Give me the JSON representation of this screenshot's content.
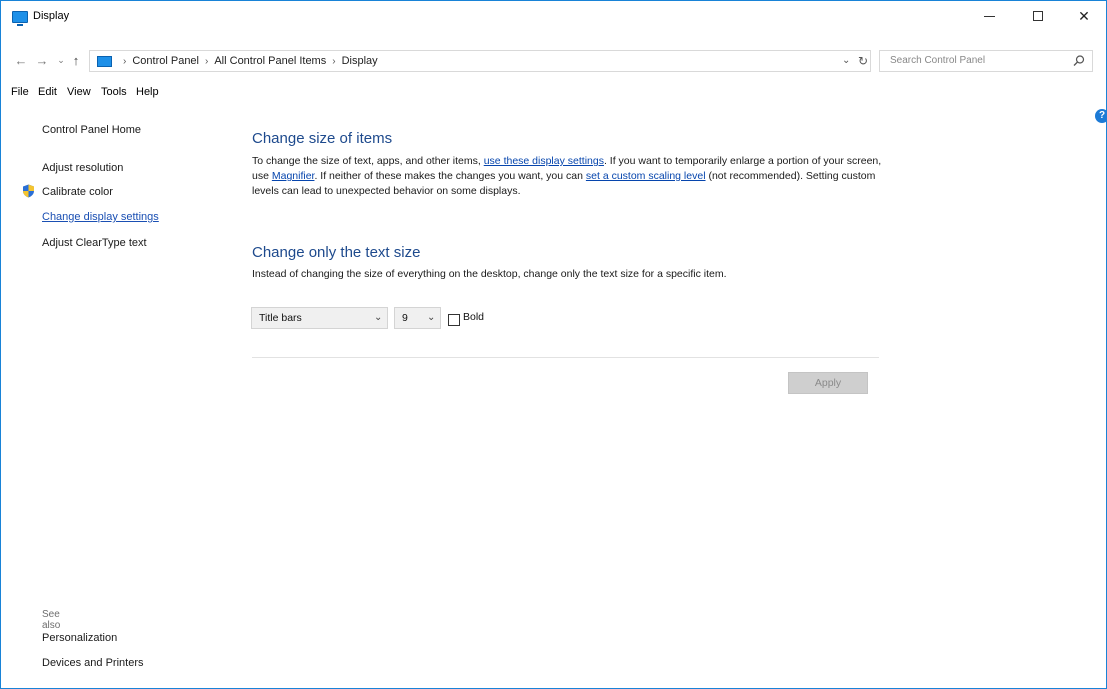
{
  "window": {
    "title": "Display"
  },
  "address": {
    "crumbs": [
      "Control Panel",
      "All Control Panel Items",
      "Display"
    ],
    "search_placeholder": "Search Control Panel"
  },
  "menu": [
    "File",
    "Edit",
    "View",
    "Tools",
    "Help"
  ],
  "sidebar": {
    "home": "Control Panel Home",
    "items": [
      {
        "label": "Adjust resolution"
      },
      {
        "label": "Calibrate color"
      },
      {
        "label": "Change display settings"
      },
      {
        "label": "Adjust ClearType text"
      }
    ],
    "see_also_heading": "See also",
    "see_also": [
      "Personalization",
      "Devices and Printers"
    ]
  },
  "main": {
    "size_title": "Change size of items",
    "size_para": {
      "p1": "To change the size of text, apps, and other items, ",
      "link1": "use these display settings",
      "p2": ". If you want to temporarily enlarge a portion of your screen, use ",
      "link2": "Magnifier",
      "p3": ". If neither of these makes the changes you want, you can ",
      "link3": "set a custom scaling level",
      "p4": " (not recommended). Setting custom levels can lead to unexpected behavior on some displays."
    },
    "text_title": "Change only the text size",
    "text_para": "Instead of changing the size of everything on the desktop, change only the text size for a specific item.",
    "item_select": "Title bars",
    "size_select": "9",
    "bold_label": "Bold",
    "apply_label": "Apply"
  },
  "colors": {
    "accent": "#1883d7",
    "heading": "#1e4a8d",
    "link": "#0645ad"
  }
}
